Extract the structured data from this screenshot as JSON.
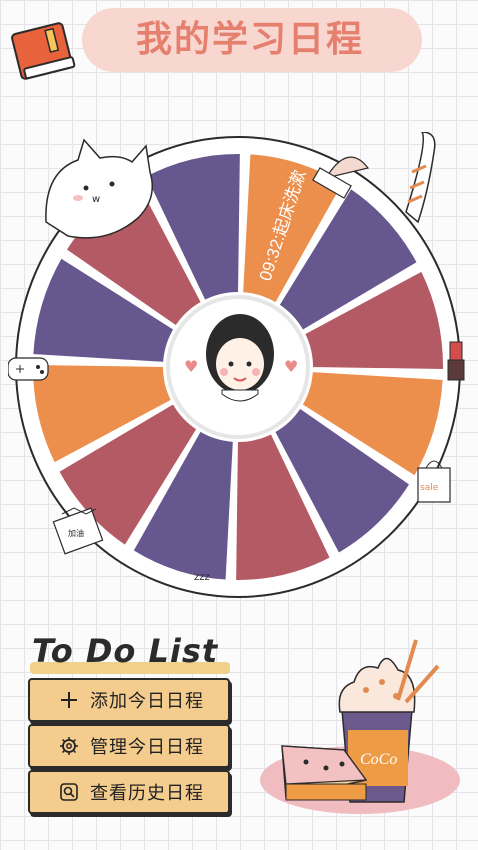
{
  "header": {
    "title": "我的学习日程"
  },
  "wheel": {
    "highlight_label": "09:32:起床洗漱",
    "sticker_text_sale": "sale",
    "sticker_text_note": "加油",
    "sleep_text": "zzz"
  },
  "todo": {
    "title": "To Do List",
    "buttons": [
      {
        "label": "添加今日日程",
        "icon": "plus-icon"
      },
      {
        "label": "管理今日日程",
        "icon": "gear-icon"
      },
      {
        "label": "查看历史日程",
        "icon": "search-icon"
      }
    ]
  },
  "dessert": {
    "cup_text": "CoCo"
  },
  "colors": {
    "orange": "#ec8e4c",
    "purple": "#67578f",
    "rose": "#b45a64",
    "title": "#e57f6e",
    "button": "#f4cc8e"
  }
}
